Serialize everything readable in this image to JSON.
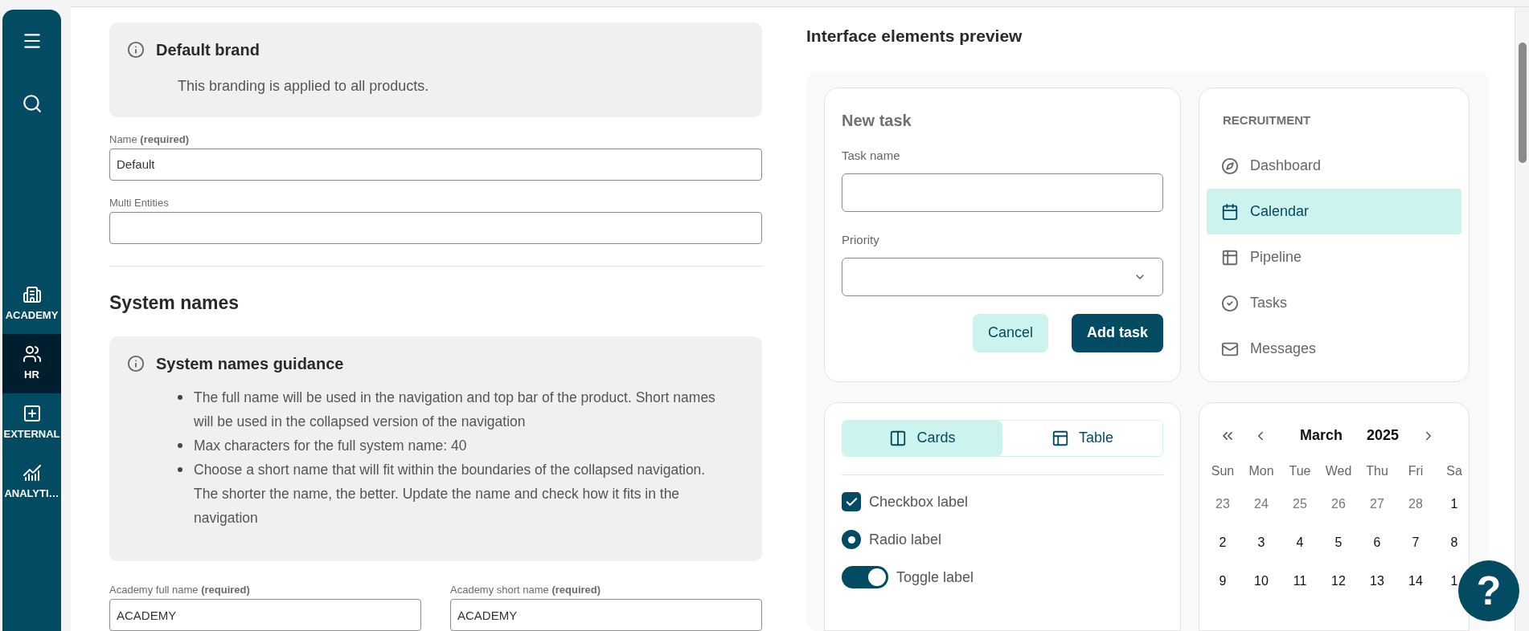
{
  "sidebar": {
    "items": [
      {
        "label": "ACADEMY",
        "selected": false
      },
      {
        "label": "HR",
        "selected": true
      },
      {
        "label": "EXTERNAL",
        "selected": false
      },
      {
        "label": "ANALYTI…",
        "selected": false
      }
    ]
  },
  "default_brand": {
    "title": "Default brand",
    "text": "This branding is applied to all products."
  },
  "fields": [
    {
      "label": "Name **(required)**",
      "value": "Default"
    },
    {
      "label": "Multi Entities"
    }
  ],
  "system_names": {
    "title": "System names",
    "guidance": {
      "title": "System names guidance",
      "bullets": [
        "The full name will be used in the navigation and top bar of the product. Short names will be used in the collapsed version of the navigation",
        "Max characters for the full system name: 40",
        "Choose a short name that will fit within the boundaries of the collapsed navigation. The shorter the name, the better. Update the name and check how it fits in the navigation"
      ]
    },
    "fields": [
      {
        "label": "Academy full name **(required)**",
        "value": "ACADEMY"
      },
      {
        "label": "Academy short name **(required)**",
        "value": "ACADEMY"
      }
    ]
  },
  "preview": {
    "title": "Interface elements preview",
    "task_form": {
      "title": "New task",
      "task_label": "Task name",
      "priority_label": "Priority",
      "cancel": "Cancel",
      "submit": "Add task"
    },
    "view_toggle": [
      {
        "label": "Cards",
        "selected": true
      },
      {
        "label": "Table",
        "selected": false
      }
    ],
    "controls": [
      {
        "kind": "checkbox",
        "label": "Checkbox label",
        "checked": true
      },
      {
        "kind": "radio",
        "label": "Radio label",
        "checked": true
      },
      {
        "kind": "toggle",
        "label": "Toggle label",
        "on": true
      }
    ],
    "nav": {
      "section": "RECRUITMENT",
      "items": [
        {
          "label": "Dashboard",
          "selected": false
        },
        {
          "label": "Calendar",
          "selected": true
        },
        {
          "label": "Pipeline",
          "selected": false
        },
        {
          "label": "Tasks",
          "selected": false
        },
        {
          "label": "Messages",
          "selected": false
        }
      ]
    },
    "calendar": {
      "month": "March",
      "year": "2025",
      "weekdays": [
        "Sun",
        "Mon",
        "Tue",
        "Wed",
        "Thu",
        "Fri",
        "Sa"
      ],
      "weeks": [
        [
          {
            "day": "23",
            "outside": true
          },
          {
            "day": "24",
            "outside": true
          },
          {
            "day": "25",
            "outside": true
          },
          {
            "day": "26",
            "outside": true
          },
          {
            "day": "27",
            "outside": true
          },
          {
            "day": "28",
            "outside": true
          },
          {
            "day": "1",
            "outside": false
          }
        ],
        [
          {
            "day": "2",
            "outside": false
          },
          {
            "day": "3",
            "outside": false
          },
          {
            "day": "4",
            "outside": false
          },
          {
            "day": "5",
            "outside": false
          },
          {
            "day": "6",
            "outside": false
          },
          {
            "day": "7",
            "outside": false
          },
          {
            "day": "8",
            "outside": false
          }
        ],
        [
          {
            "day": "9",
            "outside": false
          },
          {
            "day": "10",
            "outside": false
          },
          {
            "day": "11",
            "outside": false
          },
          {
            "day": "12",
            "outside": false
          },
          {
            "day": "13",
            "outside": false
          },
          {
            "day": "14",
            "outside": false
          },
          {
            "day": "1",
            "outside": false
          }
        ]
      ]
    }
  },
  "help_button": {
    "label": "?"
  }
}
